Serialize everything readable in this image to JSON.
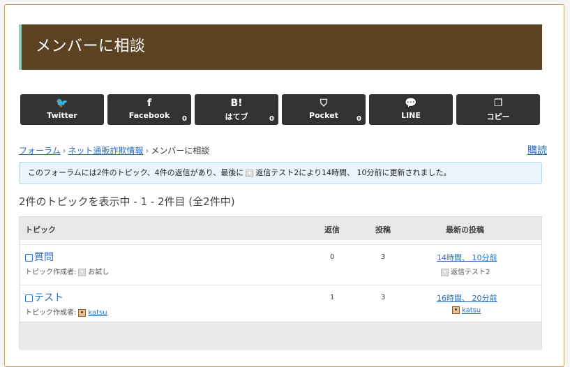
{
  "header": {
    "title": "メンバーに相談"
  },
  "share": [
    {
      "label": "Twitter",
      "icon": "twitter-icon",
      "glyph": "🐦",
      "count": ""
    },
    {
      "label": "Facebook",
      "icon": "facebook-icon",
      "glyph": "f",
      "count": "0"
    },
    {
      "label": "はてブ",
      "icon": "hatena-bookmark-icon",
      "glyph": "B!",
      "count": "0"
    },
    {
      "label": "Pocket",
      "icon": "pocket-icon",
      "glyph": "⛉",
      "count": "0"
    },
    {
      "label": "LINE",
      "icon": "line-icon",
      "glyph": "💬",
      "count": ""
    },
    {
      "label": "コピー",
      "icon": "copy-icon",
      "glyph": "❐",
      "count": ""
    }
  ],
  "breadcrumb": {
    "forum": "フォーラム",
    "category": "ネット通販詐欺情報",
    "current": "メンバーに相談",
    "sep": "›"
  },
  "subscribe": "購読",
  "notice": {
    "prefix": "このフォーラムには2件のトピック、4件の返信があり、最後に",
    "user": "返信テスト2",
    "suffix": "により14時間、 10分前に更新されました。"
  },
  "count_title": "2件のトピックを表示中 - 1 - 2件目 (全2件中)",
  "table": {
    "headers": {
      "topic": "トピック",
      "replies": "返信",
      "posts": "投稿",
      "freshness": "最新の投稿"
    },
    "author_label": "トピック作成者:",
    "rows": [
      {
        "title": "質問",
        "author": "お試し",
        "author_link": false,
        "replies": "0",
        "posts": "3",
        "fresh": "14時間、 10分前",
        "fresh_author": "返信テスト2",
        "fresh_link": false
      },
      {
        "title": "テスト",
        "author": "katsu",
        "author_link": true,
        "replies": "1",
        "posts": "3",
        "fresh": "16時間、 20分前",
        "fresh_author": "katsu",
        "fresh_link": true
      }
    ]
  },
  "colors": {
    "header_bg": "#5a4222",
    "header_accent": "#8fd0c0",
    "share_bg": "#333333",
    "link": "#2a6ebb",
    "notice_bg": "#eaf4fc"
  }
}
